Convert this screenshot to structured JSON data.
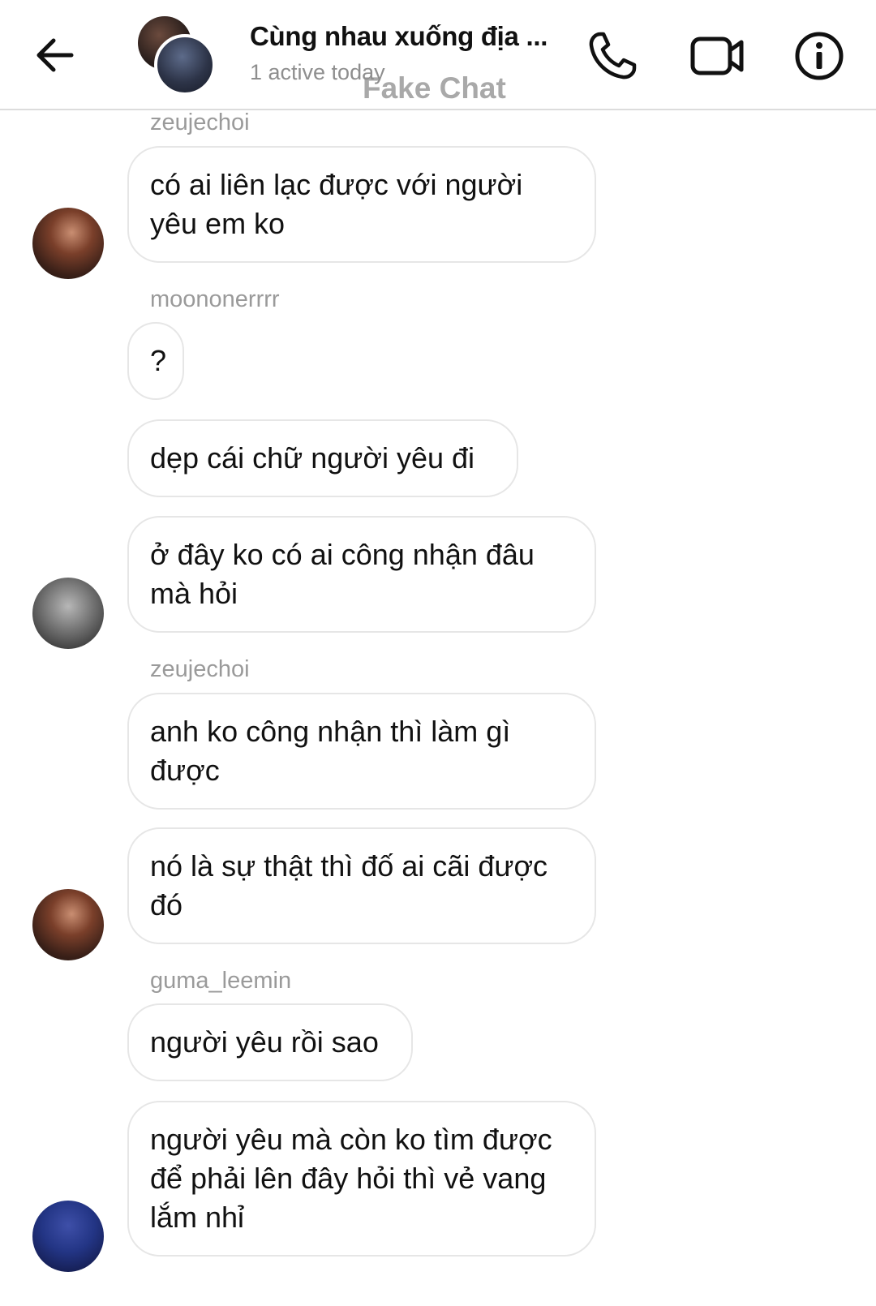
{
  "header": {
    "back_icon": "back-arrow-icon",
    "title": "Cùng nhau xuống địa ...",
    "subtitle": "1 active today",
    "watermark": "Fake Chat",
    "call_icon": "phone-icon",
    "video_icon": "video-camera-icon",
    "info_icon": "info-icon"
  },
  "messages": [
    {
      "sender": "zeujechoi",
      "text": "có ai liên lạc được với người yêu em ko"
    },
    {
      "sender": "moononerrrr",
      "text": "?"
    },
    {
      "text": "dẹp cái chữ người yêu đi"
    },
    {
      "text": "ở đây ko có ai công nhận đâu mà hỏi"
    },
    {
      "sender": "zeujechoi",
      "text": "anh ko công nhận thì làm gì được"
    },
    {
      "text": "nó là sự thật thì đố ai cãi được đó"
    },
    {
      "sender": "guma_leemin",
      "text": "người yêu rồi sao"
    },
    {
      "text": "người yêu mà còn ko tìm được để phải lên đây hỏi thì vẻ vang lắm nhỉ"
    }
  ]
}
